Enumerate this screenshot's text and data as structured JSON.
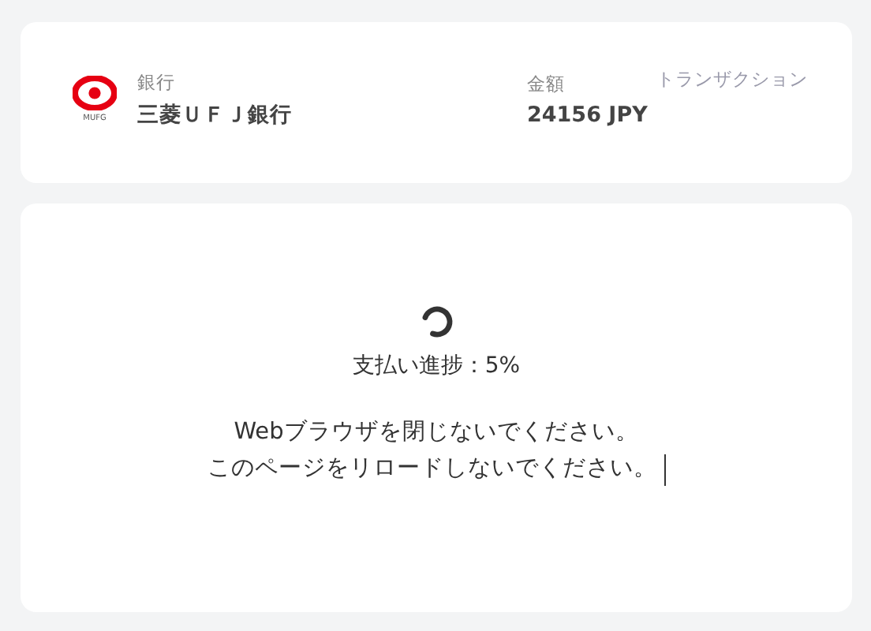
{
  "bank": {
    "logo_text": "MUFG",
    "label": "銀行",
    "name": "三菱ＵＦＪ銀行"
  },
  "amount": {
    "label": "金額",
    "value": "24156 JPY"
  },
  "transaction": {
    "label": "トランザクション"
  },
  "progress": {
    "text": "支払い進捗：5%"
  },
  "messages": [
    "Webブラウザを閉じないでください。",
    "このページをリロードしないでください。"
  ]
}
